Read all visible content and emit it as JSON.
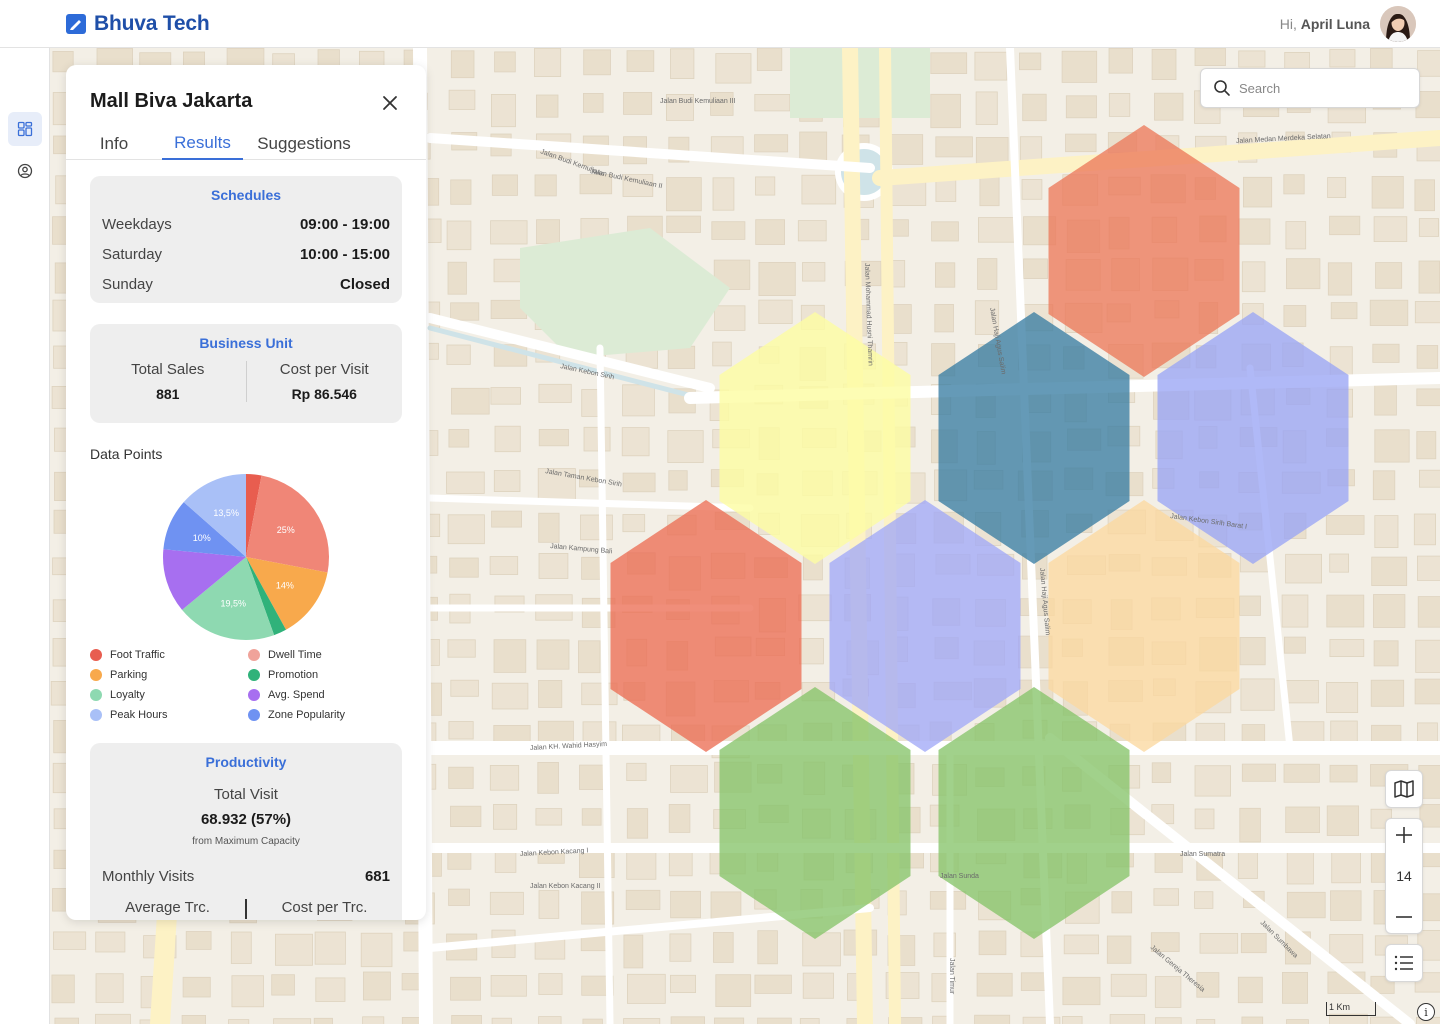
{
  "app": {
    "brand": "Bhuva Tech",
    "greeting_prefix": "Hi, ",
    "user_name": "April Luna"
  },
  "search": {
    "placeholder": "Search"
  },
  "map": {
    "zoom_level": "14",
    "scale_label": "1 Km",
    "info_label": "i",
    "streets": [
      "Jalan Medan Merdeka Selatan",
      "Jalan Budi Kemuliaan",
      "Jalan Budi Kemuliaan II",
      "Jalan Budi Kemuliaan III",
      "Jalan Kebon Sirih",
      "Jalan Mohammad Husni Thamrin",
      "Jalan Haji Agus Salim",
      "Jalan Kebon Sirih Barat I",
      "Jalan Kampung Bali",
      "Jalan Taman Kebon Sirih",
      "Jalan KH. Wahid Hasyim",
      "Jalan Kebon Kacang I",
      "Jalan Kebon Kacang II",
      "Jalan Sunda",
      "Jalan Sumatra",
      "Jalan Gereja Theresia",
      "Jalan Sumbawa",
      "Jalan Timur",
      "Jalan Haji Agus Salim"
    ],
    "hexagons": [
      {
        "id": "n",
        "color": "#ec7a5b"
      },
      {
        "id": "w",
        "color": "#fdfda3"
      },
      {
        "id": "c",
        "color": "#3a7ea3"
      },
      {
        "id": "e",
        "color": "#9aa5f5"
      },
      {
        "id": "sw",
        "color": "#ec6e55"
      },
      {
        "id": "s",
        "color": "#a2a9f7"
      },
      {
        "id": "se",
        "color": "#fbd9a0"
      },
      {
        "id": "ssw",
        "color": "#86c46a"
      },
      {
        "id": "sse",
        "color": "#86c46a"
      }
    ]
  },
  "panel": {
    "title": "Mall Biva Jakarta",
    "tabs": [
      "Info",
      "Results",
      "Suggestions"
    ],
    "active_tab": "Results",
    "schedules": {
      "title": "Schedules",
      "rows": [
        {
          "label": "Weekdays",
          "value": "09:00 - 19:00"
        },
        {
          "label": "Saturday",
          "value": "10:00 - 15:00"
        },
        {
          "label": "Sunday",
          "value": "Closed"
        }
      ]
    },
    "business_unit": {
      "title": "Business Unit",
      "total_sales_label": "Total Sales",
      "total_sales_value": "881",
      "cost_label": "Cost per Visit",
      "cost_value": "Rp 86.546"
    },
    "data_points_label": "Data Points",
    "productivity": {
      "title": "Productivity",
      "total_visit_label": "Total Visit",
      "total_visit_value": "68.932 (57%)",
      "capacity_note": "from Maximum Capacity",
      "monthly_label": "Monthly Visits",
      "monthly_value": "681",
      "avg_label": "Average Trc.",
      "cost_label": "Cost per Trc."
    }
  },
  "chart_data": {
    "type": "pie",
    "slices": [
      {
        "name": "Foot Traffic",
        "value": 3,
        "label": "",
        "color": "#e85d4f"
      },
      {
        "name": "Dwell Time",
        "value": 25,
        "label": "25%",
        "color": "#f08677"
      },
      {
        "name": "Parking",
        "value": 14,
        "label": "14%",
        "color": "#f8a94c"
      },
      {
        "name": "Promotion",
        "value": 2.5,
        "label": "",
        "color": "#30b27a"
      },
      {
        "name": "Loyalty",
        "value": 19.5,
        "label": "19,5%",
        "color": "#8ed9b1"
      },
      {
        "name": "Avg. Spend",
        "value": 12.5,
        "label": "",
        "color": "#a76ff0"
      },
      {
        "name": "Zone Popularity",
        "value": 10,
        "label": "10%",
        "color": "#6f92f2"
      },
      {
        "name": "Peak Hours",
        "value": 13.5,
        "label": "13,5%",
        "color": "#a9c0f7"
      }
    ],
    "legend": [
      {
        "name": "Foot Traffic",
        "color": "#e85d4f"
      },
      {
        "name": "Dwell Time",
        "color": "#f0a39a"
      },
      {
        "name": "Parking",
        "color": "#f8a94c"
      },
      {
        "name": "Promotion",
        "color": "#30b27a"
      },
      {
        "name": "Loyalty",
        "color": "#8ed9b1"
      },
      {
        "name": "Avg. Spend",
        "color": "#a76ff0"
      },
      {
        "name": "Peak Hours",
        "color": "#a9c0f7"
      },
      {
        "name": "Zone Popularity",
        "color": "#6f92f2"
      }
    ]
  }
}
